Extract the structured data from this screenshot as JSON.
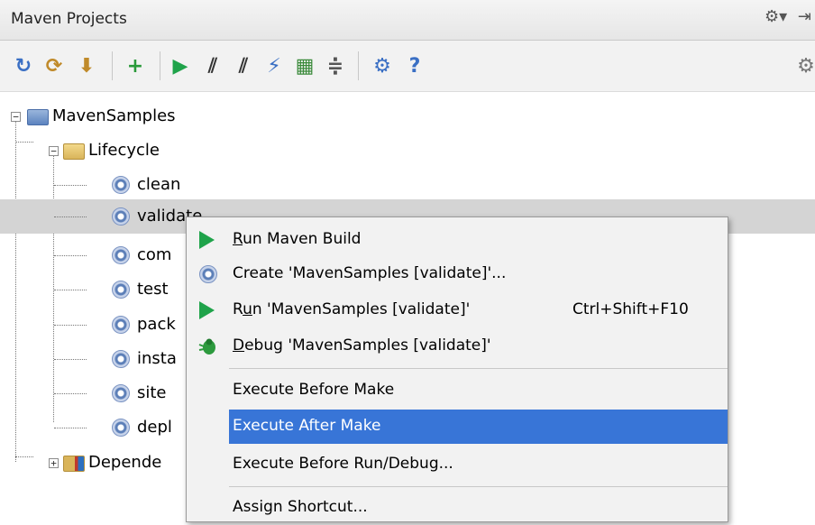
{
  "header": {
    "title": "Maven Projects",
    "actions": [
      {
        "icon": "gear-icon",
        "text": "⚙▾"
      },
      {
        "icon": "hide-icon",
        "text": "⇥"
      }
    ]
  },
  "toolbar": {
    "buttons": [
      {
        "name": "reimport-icon",
        "glyph": "↻",
        "color": "#3a6fc4"
      },
      {
        "name": "generate-sources-icon",
        "glyph": "⟳",
        "color": "#c08a2a"
      },
      {
        "name": "download-icon",
        "glyph": "⬇",
        "color": "#c08a2a"
      },
      {
        "name": "add-icon",
        "glyph": "+",
        "color": "#2a9a3a"
      },
      {
        "name": "run-icon",
        "glyph": "▶",
        "color": "#1fa34a"
      },
      {
        "name": "toggle-offline-icon",
        "glyph": "⫽",
        "color": "#333"
      },
      {
        "name": "skip-tests-icon",
        "glyph": "⫽",
        "color": "#333"
      },
      {
        "name": "execute-goal-icon",
        "glyph": "⚡",
        "color": "#3a6fc4"
      },
      {
        "name": "show-dependencies-icon",
        "glyph": "▦",
        "color": "#3a8a3a"
      },
      {
        "name": "collapse-all-icon",
        "glyph": "≑",
        "color": "#555"
      },
      {
        "name": "settings-icon",
        "glyph": "⚙",
        "color": "#3a6fc4"
      },
      {
        "name": "help-icon",
        "glyph": "?",
        "color": "#3a6fc4"
      },
      {
        "name": "overflow-gear-icon",
        "glyph": "⚙",
        "color": "#777"
      }
    ]
  },
  "tree": {
    "root": "MavenSamples",
    "lifecycle": "Lifecycle",
    "phases": [
      "clean",
      "validate",
      "com",
      "test",
      "pack",
      "insta",
      "site",
      "depl"
    ],
    "dependencies": "Depende"
  },
  "context_menu": {
    "run_maven_build": {
      "prefix": "",
      "mnemonic": "R",
      "suffix": "un Maven Build"
    },
    "create_config": "Create 'MavenSamples [validate]'...",
    "run_config": {
      "prefix": "R",
      "mnemonic": "u",
      "suffix": "n 'MavenSamples [validate]'"
    },
    "run_shortcut": "Ctrl+Shift+F10",
    "debug_config": {
      "prefix": "",
      "mnemonic": "D",
      "suffix": "ebug 'MavenSamples [validate]'"
    },
    "execute_before_make": "Execute Before Make",
    "execute_after_make": "Execute After Make",
    "execute_before_run": "Execute Before Run/Debug...",
    "assign_shortcut": "Assign Shortcut..."
  }
}
